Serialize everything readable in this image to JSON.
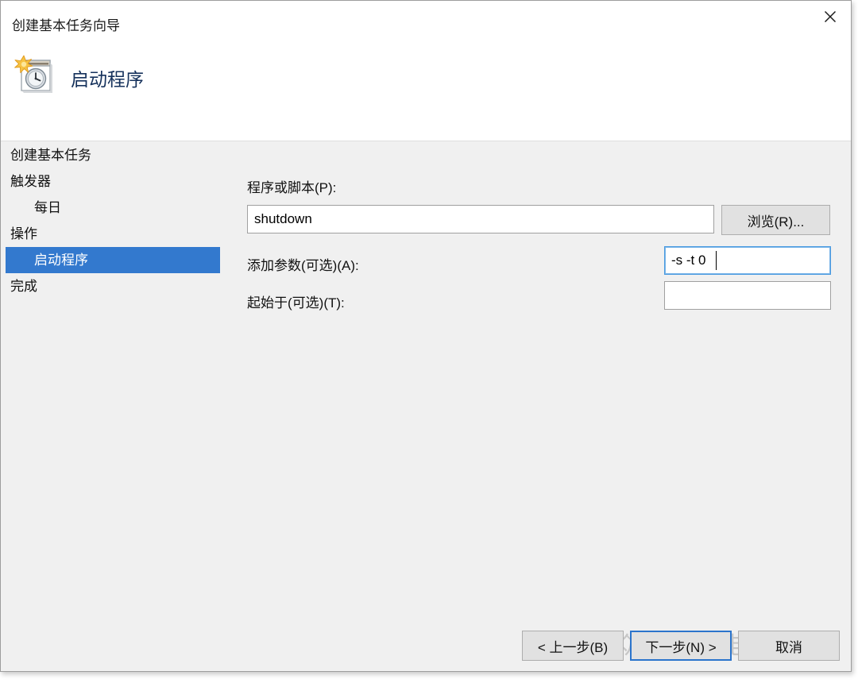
{
  "window": {
    "title": "创建基本任务向导",
    "close_icon": "close-icon"
  },
  "header": {
    "title": "启动程序",
    "icon": "task-scheduler-clock-icon"
  },
  "sidebar": {
    "items": [
      {
        "label": "创建基本任务",
        "indent": false,
        "selected": false
      },
      {
        "label": "触发器",
        "indent": false,
        "selected": false
      },
      {
        "label": "每日",
        "indent": true,
        "selected": false
      },
      {
        "label": "操作",
        "indent": false,
        "selected": false
      },
      {
        "label": "启动程序",
        "indent": true,
        "selected": true
      },
      {
        "label": "完成",
        "indent": false,
        "selected": false
      }
    ],
    "selected_color": "#3379ce"
  },
  "form": {
    "program": {
      "label": "程序或脚本(P):",
      "value": "shutdown",
      "placeholder": ""
    },
    "arguments": {
      "label": "添加参数(可选)(A):",
      "value": "-s -t 0",
      "placeholder": "",
      "focused": true
    },
    "start_in": {
      "label": "起始于(可选)(T):",
      "value": "",
      "placeholder": ""
    },
    "browse_label": "浏览(R)..."
  },
  "buttons": {
    "back": "< 上一步(B)",
    "next": "下一步(N) >",
    "cancel": "取消",
    "default_button": "next",
    "default_border_color": "#2b74cc"
  },
  "watermark": {
    "text": "公众号 小白电脑技术",
    "icon": "wechat-icon"
  }
}
